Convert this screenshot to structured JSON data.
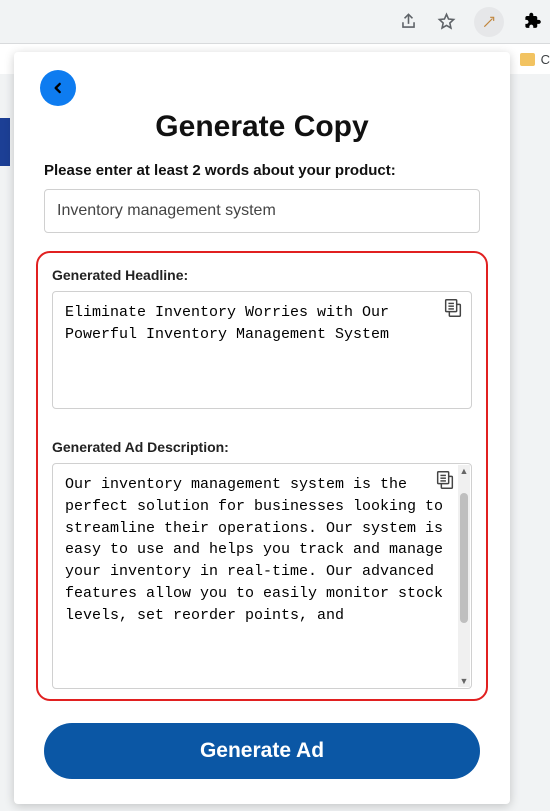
{
  "browser": {
    "bookmark_letter": "C"
  },
  "header": {
    "title": "Generate Copy"
  },
  "form": {
    "prompt_label": "Please enter at least 2 words about your product:",
    "product_value": "Inventory management system"
  },
  "generated": {
    "headline_label": "Generated Headline:",
    "headline_text": "Eliminate Inventory Worries with Our Powerful Inventory Management System",
    "description_label": "Generated Ad Description:",
    "description_text": "Our inventory management system is the perfect solution for businesses looking to streamline their operations. Our system is easy to use and helps you track and manage your inventory in real-time. Our advanced features allow you to easily monitor stock levels, set reorder points, and"
  },
  "cta": {
    "label": "Generate Ad"
  }
}
